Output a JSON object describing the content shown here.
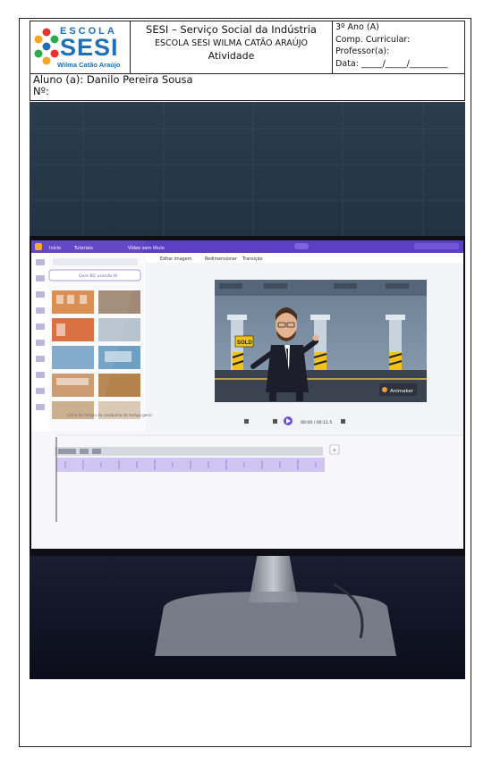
{
  "logo": {
    "escola": "ESCOLA",
    "sesi": "SESI",
    "sub": "Wilma Catão Araújo"
  },
  "header": {
    "line1": "SESI – Serviço Social da Indústria",
    "line2": "ESCOLA SESI WILMA CATÃO ARAÚJO",
    "line3": "Atividade"
  },
  "info": {
    "grade": "3º Ano (A)",
    "subject": "Comp. Curricular:",
    "teacher": "Professor(a):",
    "date": "Data: _____/_____/_________"
  },
  "student": {
    "name": "Aluno (a): Danilo Pereira Sousa",
    "number": "Nº:"
  },
  "photo": {
    "app_tabs": [
      "Início",
      "Tutoriais"
    ],
    "project_title": "Vídeo sem título",
    "search_placeholder": "Gere BG usando IA",
    "toolbar_items": [
      "Editar imagem",
      "Redimensionar",
      "Transição"
    ],
    "scene_sign": "SOLD",
    "watermark": "Animaker",
    "time_display": "00:00 / 00:11.5",
    "timeline_labels": [
      "Linha do tempo da cena",
      "Linha do tempo geral"
    ]
  }
}
